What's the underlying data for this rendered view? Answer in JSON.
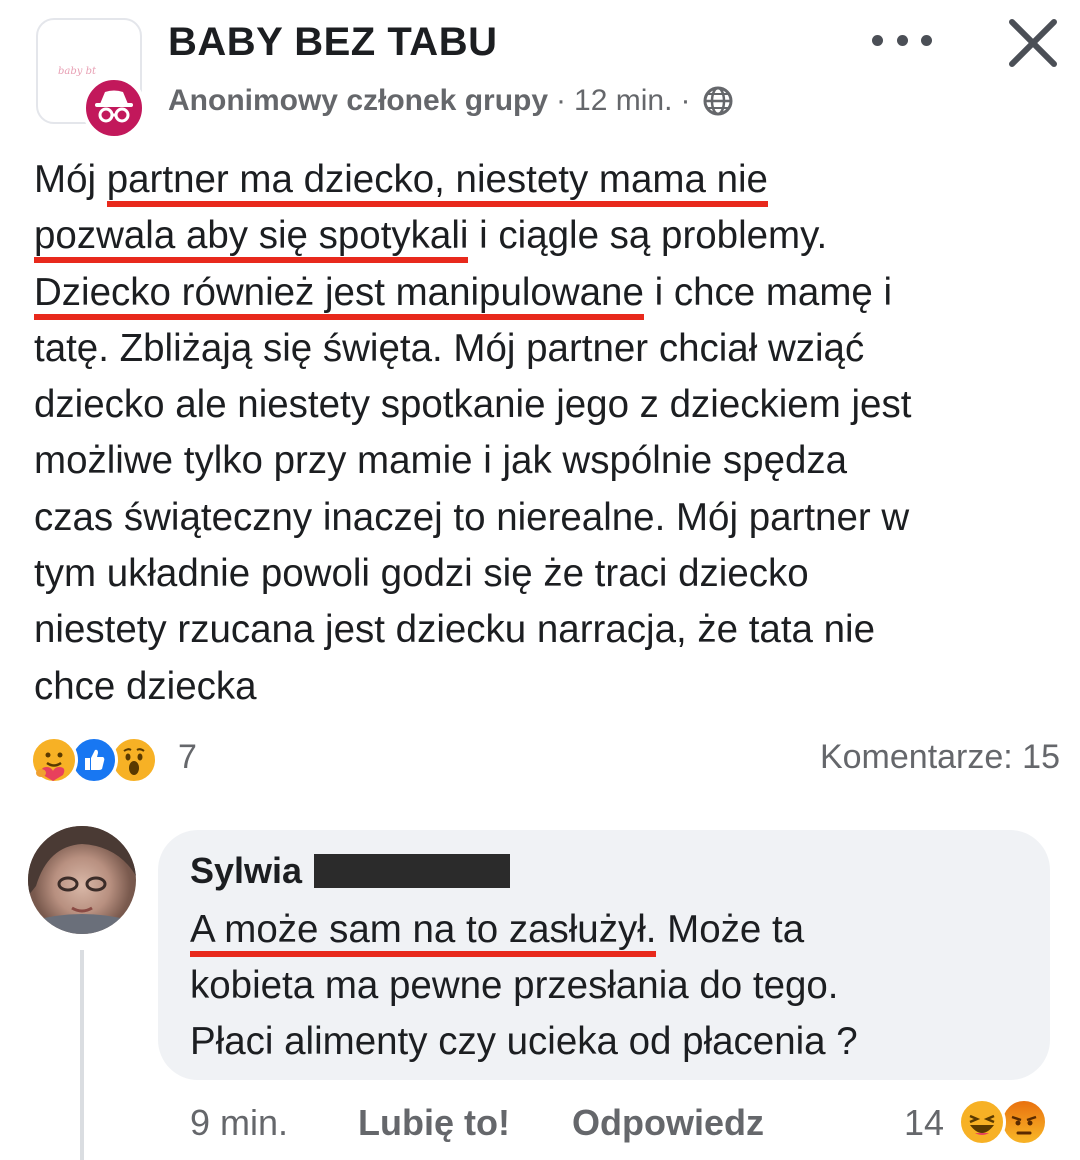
{
  "post": {
    "group_name": "BABY BEZ TABU",
    "group_logo_text": "baby bt",
    "author": "Anonimowy członek grupy",
    "separator": "·",
    "time": "12 min.",
    "audience_icon": "globe-icon",
    "lines": [
      {
        "before": "Mój ",
        "underlined": "partner ma dziecko, niestety mama nie",
        "after": ""
      },
      {
        "before": "",
        "underlined": "pozwala aby się spotykali",
        "after": " i ciągle są problemy."
      },
      {
        "before": "",
        "underlined": "Dziecko również jest manipulowane",
        "after": " i chce mamę i"
      },
      {
        "before": "tatę. Zbliżają się święta. Mój partner chciał wziąć",
        "underlined": "",
        "after": ""
      },
      {
        "before": "dziecko ale niestety spotkanie jego z dzieckiem jest",
        "underlined": "",
        "after": ""
      },
      {
        "before": "możliwe tylko przy mamie i jak wspólnie spędza",
        "underlined": "",
        "after": ""
      },
      {
        "before": "czas świąteczny inaczej to nierealne. Mój partner w",
        "underlined": "",
        "after": ""
      },
      {
        "before": "tym układnie powoli godzi się że traci dziecko",
        "underlined": "",
        "after": ""
      },
      {
        "before": "niestety rzucana jest dziecku narracja, że tata nie",
        "underlined": "",
        "after": ""
      },
      {
        "before": "chce dziecka",
        "underlined": "",
        "after": ""
      }
    ],
    "reactions": [
      "care",
      "like",
      "wow"
    ],
    "reaction_count": "7",
    "comments_label": "Komentarze: 15"
  },
  "comment": {
    "author": "Sylwia",
    "lines": [
      {
        "before": "",
        "underlined": "A może sam na to zasłużył.",
        "after": " Może ta"
      },
      {
        "before": "kobieta ma pewne przesłania do tego.",
        "underlined": "",
        "after": ""
      },
      {
        "before": "Płaci alimenty czy ucieka od płacenia ?",
        "underlined": "",
        "after": ""
      }
    ],
    "time": "9 min.",
    "like_label": "Lubię to!",
    "reply_label": "Odpowiedz",
    "reaction_count": "14",
    "reactions": [
      "haha",
      "angry"
    ]
  },
  "colors": {
    "underline": "#e8291c",
    "anon_badge": "#c2185b",
    "bubble": "#f0f2f5",
    "secondary_text": "#65676b"
  }
}
